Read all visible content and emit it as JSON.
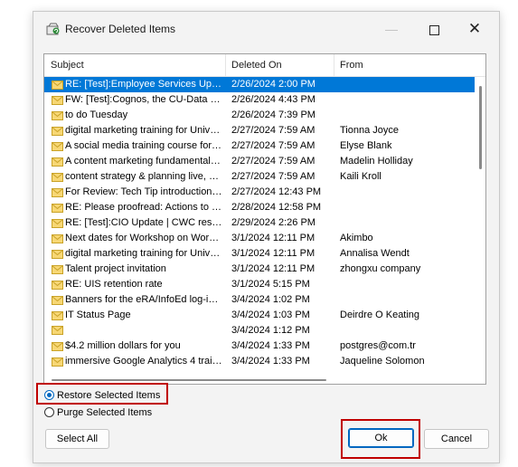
{
  "window": {
    "title": "Recover Deleted Items",
    "minimize_icon": "minimize-icon",
    "maximize_icon": "maximize-icon",
    "close_icon": "close-icon"
  },
  "list": {
    "columns": [
      "Subject",
      "Deleted On",
      "From"
    ],
    "rows": [
      {
        "subject": "RE: [Test]:Employee Services Upd…",
        "deleted": "2/26/2024 2:00 PM",
        "from": "",
        "selected": true
      },
      {
        "subject": "FW: [Test]:Cognos, the CU-Data …",
        "deleted": "2/26/2024 4:43 PM",
        "from": ""
      },
      {
        "subject": "to do Tuesday",
        "deleted": "2/26/2024 7:39 PM",
        "from": ""
      },
      {
        "subject": "digital marketing training for Unive…",
        "deleted": "2/27/2024 7:59 AM",
        "from": "Tionna Joyce"
      },
      {
        "subject": "A social media training course for …",
        "deleted": "2/27/2024 7:59 AM",
        "from": "Elyse Blank"
      },
      {
        "subject": "A content marketing fundamental…",
        "deleted": "2/27/2024 7:59 AM",
        "from": "Madelin Holliday"
      },
      {
        "subject": "content strategy & planning live, …",
        "deleted": "2/27/2024 7:59 AM",
        "from": "Kaili Kroll"
      },
      {
        "subject": "For Review: Tech Tip introduction …",
        "deleted": "2/27/2024 12:43 PM",
        "from": ""
      },
      {
        "subject": "RE: Please proofread: Actions to t…",
        "deleted": "2/28/2024 12:58 PM",
        "from": ""
      },
      {
        "subject": "RE: [Test]:CIO Update | CWC res…",
        "deleted": "2/29/2024 2:26 PM",
        "from": ""
      },
      {
        "subject": "Next dates for Workshop on Work…",
        "deleted": "3/1/2024 12:11 PM",
        "from": "Akimbo"
      },
      {
        "subject": "digital marketing training for Unive…",
        "deleted": "3/1/2024 12:11 PM",
        "from": "Annalisa Wendt"
      },
      {
        "subject": "Talent project invitation",
        "deleted": "3/1/2024 12:11 PM",
        "from": "zhongxu company"
      },
      {
        "subject": "RE: UIS retention rate",
        "deleted": "3/1/2024 5:15 PM",
        "from": ""
      },
      {
        "subject": "Banners for the eRA/InfoEd log-in…",
        "deleted": "3/4/2024 1:02 PM",
        "from": ""
      },
      {
        "subject": "IT Status Page",
        "deleted": "3/4/2024 1:03 PM",
        "from": "Deirdre O Keating"
      },
      {
        "subject": "",
        "deleted": "3/4/2024 1:12 PM",
        "from": ""
      },
      {
        "subject": "$4.2 million dollars for you",
        "deleted": "3/4/2024 1:33 PM",
        "from": "postgres@com.tr"
      },
      {
        "subject": "immersive Google Analytics 4 train…",
        "deleted": "3/4/2024 1:33 PM",
        "from": "Jaqueline Solomon"
      }
    ]
  },
  "options": {
    "restore_label": "Restore Selected Items",
    "purge_label": "Purge Selected Items",
    "selected": "restore"
  },
  "buttons": {
    "select_all": "Select All",
    "ok": "Ok",
    "cancel": "Cancel"
  },
  "colors": {
    "selection": "#0078d7",
    "highlight_box": "#c00000",
    "accent": "#0067c0"
  }
}
